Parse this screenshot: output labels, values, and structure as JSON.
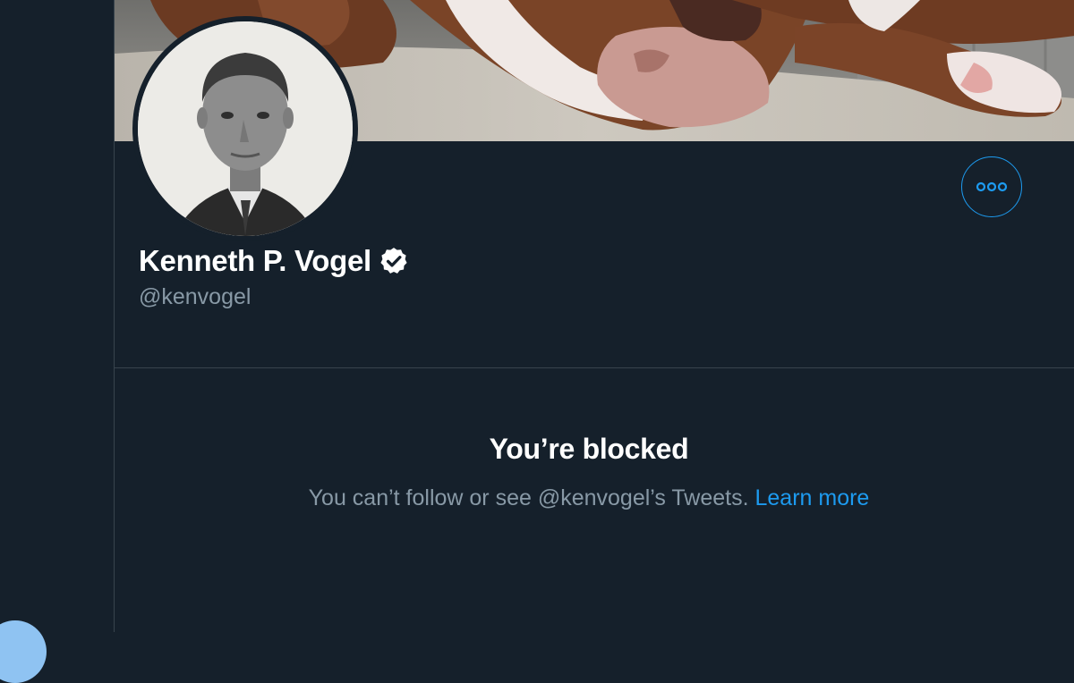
{
  "profile": {
    "display_name": "Kenneth P. Vogel",
    "handle": "@kenvogel",
    "verified": true,
    "banner_alt": "dog lying on a rug",
    "avatar_alt": "profile photo of man in suit"
  },
  "actions": {
    "more_icon": "more-dots-icon"
  },
  "blocked": {
    "title": "You’re blocked",
    "message": "You can’t follow or see @kenvogel’s Tweets.",
    "link_label": "Learn more"
  },
  "colors": {
    "background": "#15202b",
    "accent": "#1d9bf0",
    "muted_text": "#8899a6",
    "border": "#38444d"
  }
}
